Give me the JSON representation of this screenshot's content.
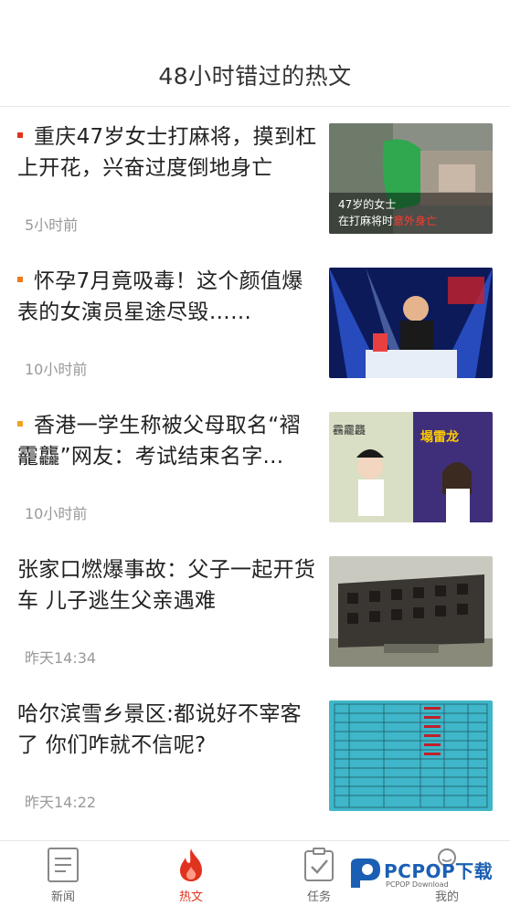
{
  "header": {
    "title": "48小时错过的热文"
  },
  "articles": [
    {
      "title": "重庆47岁女士打麻将，摸到杠上开花，兴奋过度倒地身亡",
      "time": "5小时前",
      "has_bullet": true,
      "bullet_color": "#e0331f",
      "thumb_caption": "47岁的女士在打麻将时意外身亡"
    },
    {
      "title": "怀孕7月竟吸毒！这个颜值爆表的女演员星途尽毁……",
      "time": "10小时前",
      "has_bullet": true,
      "bullet_color": "#f07a20"
    },
    {
      "title": "香港一学生称被父母取名“褶靇龘”网友：考试结束名字...",
      "time": "10小时前",
      "has_bullet": true,
      "bullet_color": "#f0a020",
      "thumb_label": "靏靇龘"
    },
    {
      "title": "张家口燃爆事故：父子一起开货车 儿子逃生父亲遇难",
      "time": "昨天14:34",
      "has_bullet": false
    },
    {
      "title": "哈尔滨雪乡景区:都说好不宰客了 你们咋就不信呢?",
      "time": "昨天14:22",
      "has_bullet": false
    }
  ],
  "tabbar": {
    "tabs": [
      {
        "label": "新闻",
        "icon": "document-icon",
        "active": false
      },
      {
        "label": "热文",
        "icon": "flame-icon",
        "active": true
      },
      {
        "label": "任务",
        "icon": "task-check-icon",
        "active": false
      },
      {
        "label": "我的",
        "icon": "profile-icon",
        "active": false
      }
    ]
  },
  "watermark": {
    "brand": "PCPOP下载",
    "sub": "PCPOP Download"
  },
  "colors": {
    "accent": "#e0331f",
    "text": "#222222",
    "muted": "#999999",
    "divider": "#e6e6e6"
  }
}
